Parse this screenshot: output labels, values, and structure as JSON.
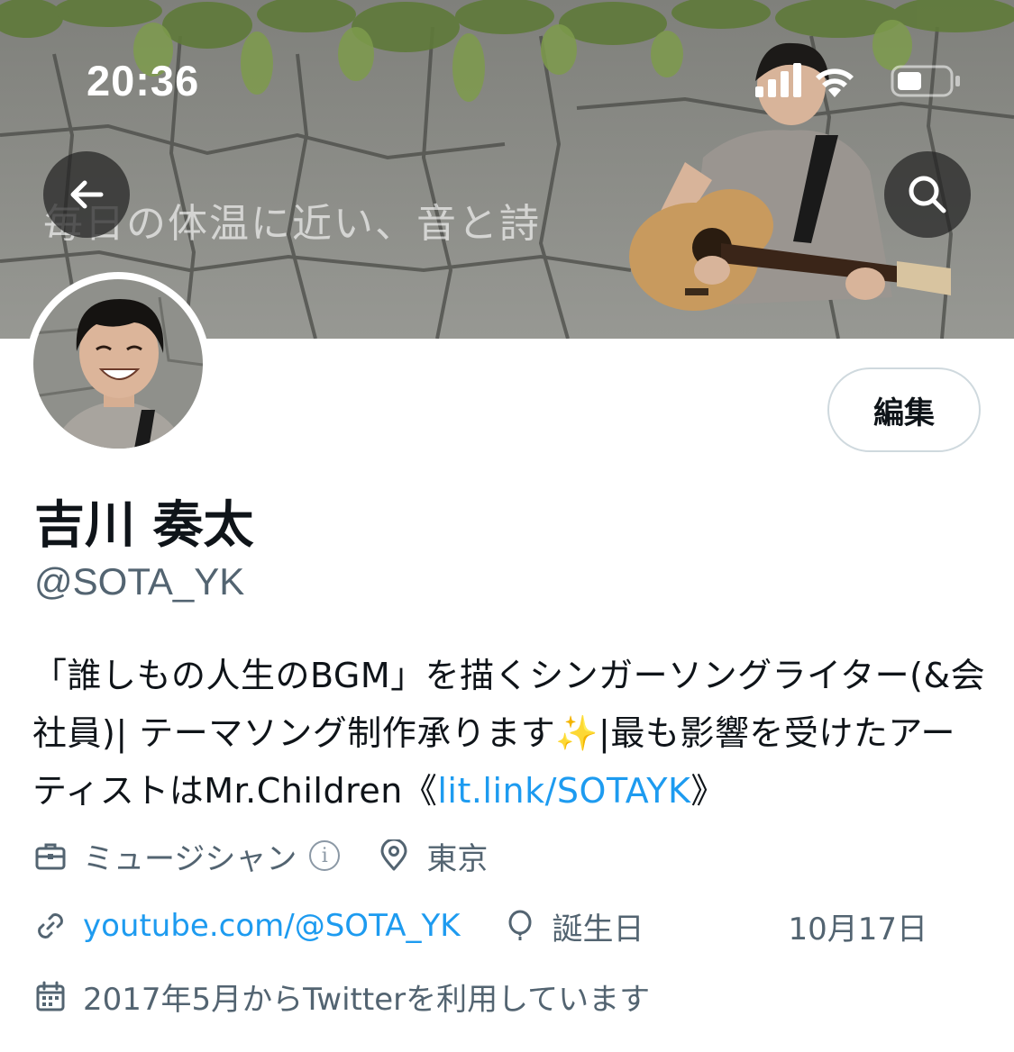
{
  "status_bar": {
    "time": "20:36",
    "icons": [
      "cellular-signal-icon",
      "wifi-icon",
      "battery-icon"
    ]
  },
  "header": {
    "banner_caption": "毎日の体温に近い、音と詩",
    "back_icon": "arrow-left-icon",
    "search_icon": "search-icon"
  },
  "profile": {
    "edit_label": "編集",
    "display_name": "吉川 奏太",
    "handle": "@SOTA_YK",
    "bio": {
      "text": "「誰しもの人生のBGM」を描くシンガーソングライター(&会社員)| テーマソング制作承ります✨|最も影響を受けたアーティストはMr.Children《",
      "link": "lit.link/SOTAYK",
      "suffix": "》"
    },
    "meta": {
      "category": "ミュージシャン",
      "category_info": "i",
      "location": "東京",
      "website": "youtube.com/@SOTA_YK",
      "birthday_label": "誕生日",
      "birthday_value": "10月17日",
      "joined": "2017年5月からTwitterを利用しています"
    }
  },
  "colors": {
    "text_primary": "#0f1419",
    "text_secondary": "#536471",
    "link": "#1d9bf0",
    "border": "#cfd9de"
  }
}
